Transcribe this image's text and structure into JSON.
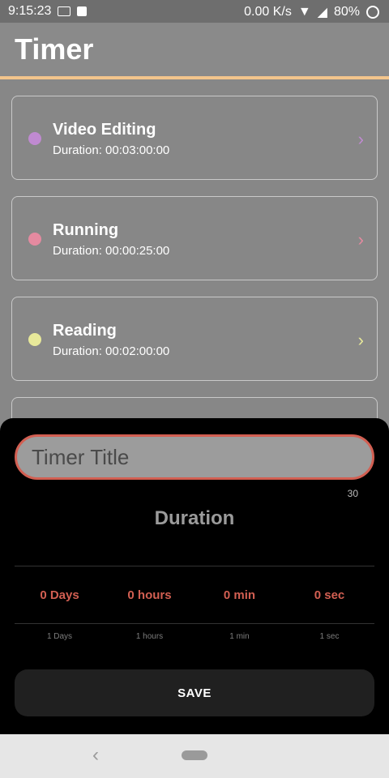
{
  "status": {
    "time": "9:15:23",
    "speed": "0.00 K/s",
    "battery": "80%"
  },
  "header": {
    "title": "Timer"
  },
  "timers": [
    {
      "name": "Video Editing",
      "duration": "Duration: 00:03:00:00",
      "color": "#c08ad1"
    },
    {
      "name": "Running",
      "duration": "Duration: 00:00:25:00",
      "color": "#e58aa0"
    },
    {
      "name": "Reading",
      "duration": "Duration: 00:02:00:00",
      "color": "#e8e99a"
    }
  ],
  "sheet": {
    "title_placeholder": "Timer Title",
    "title_value": "",
    "char_limit": "30",
    "duration_label": "Duration",
    "picker": {
      "selected": [
        "0 Days",
        "0 hours",
        "0 min",
        "0 sec"
      ],
      "next": [
        "1 Days",
        "1 hours",
        "1 min",
        "1 sec"
      ]
    },
    "save_label": "SAVE"
  }
}
